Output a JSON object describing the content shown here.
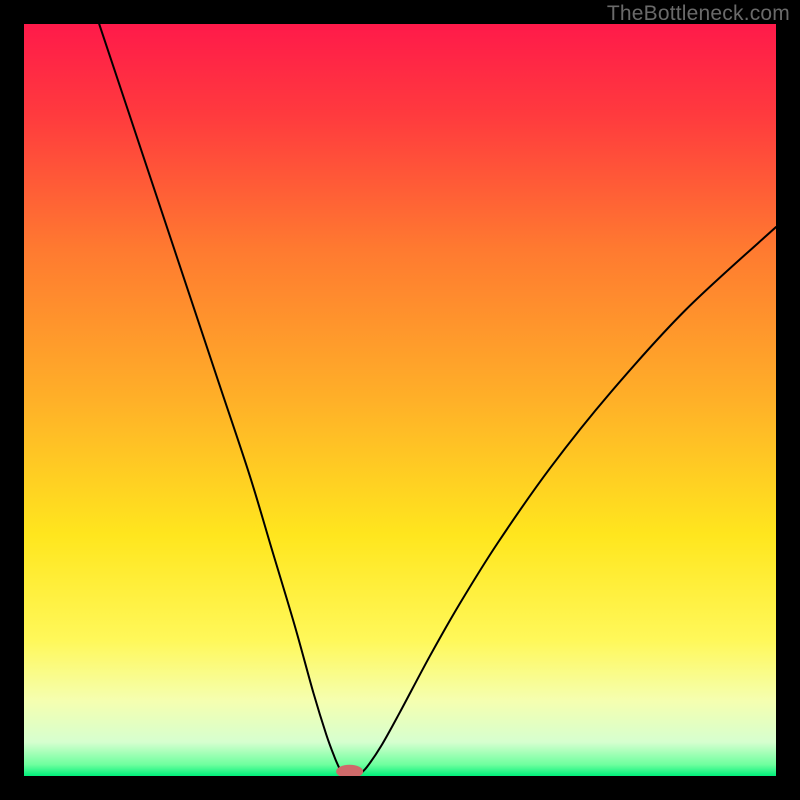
{
  "watermark": "TheBottleneck.com",
  "chart_data": {
    "type": "line",
    "title": "",
    "xlabel": "",
    "ylabel": "",
    "xlim": [
      0,
      100
    ],
    "ylim": [
      0,
      100
    ],
    "grid": false,
    "legend": false,
    "background_gradient": {
      "stops": [
        {
          "offset": 0,
          "color": "#ff1a4a"
        },
        {
          "offset": 0.12,
          "color": "#ff3a3e"
        },
        {
          "offset": 0.3,
          "color": "#ff7a30"
        },
        {
          "offset": 0.5,
          "color": "#ffb028"
        },
        {
          "offset": 0.68,
          "color": "#ffe61e"
        },
        {
          "offset": 0.82,
          "color": "#fff85a"
        },
        {
          "offset": 0.9,
          "color": "#f5ffb0"
        },
        {
          "offset": 0.955,
          "color": "#d6ffcf"
        },
        {
          "offset": 0.985,
          "color": "#6eff9e"
        },
        {
          "offset": 1.0,
          "color": "#00ef7a"
        }
      ]
    },
    "series": [
      {
        "name": "curve",
        "x": [
          10,
          14,
          18,
          22,
          26,
          30,
          33,
          36,
          38.5,
          40.2,
          41.3,
          42.0,
          42.4,
          42.7,
          44.0,
          44.6,
          45.6,
          47.5,
          50,
          54,
          58,
          63,
          70,
          78,
          88,
          100
        ],
        "y": [
          100,
          88,
          76,
          64,
          52,
          40,
          30,
          20,
          11,
          5.5,
          2.5,
          0.9,
          0.25,
          0.1,
          0.1,
          0.25,
          1.2,
          4,
          8.5,
          16,
          23,
          31,
          41,
          51,
          62,
          73
        ]
      }
    ],
    "marker": {
      "name": "bottleneck-marker",
      "x": 43.3,
      "y": 0.6,
      "rx": 1.8,
      "ry": 0.9,
      "color": "#cf6a6a"
    }
  }
}
